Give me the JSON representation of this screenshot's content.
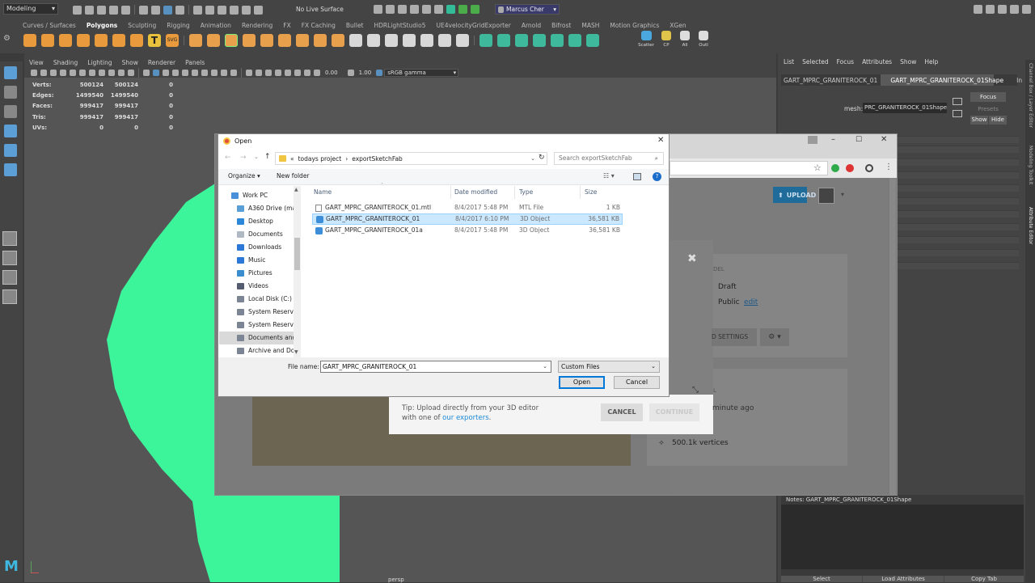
{
  "maya": {
    "mode": "Modeling",
    "live_surface": "No Live Surface",
    "user": "Marcus Cher",
    "shelf_tabs": [
      "Curves / Surfaces",
      "Polygons",
      "Sculpting",
      "Rigging",
      "Animation",
      "Rendering",
      "FX",
      "FX Caching",
      "Bullet",
      "HDRLightStudio5",
      "UE4velocityGridExporter",
      "Arnold",
      "Bifrost",
      "MASH",
      "Motion Graphics",
      "XGen"
    ],
    "shelf_labels": {
      "scatter": "Scatter",
      "cp": "CP",
      "all": "All",
      "outl": "Outl"
    },
    "viewport_menu": [
      "View",
      "Shading",
      "Lighting",
      "Show",
      "Renderer",
      "Panels"
    ],
    "exposure": "0.00",
    "gamma": "1.00",
    "color_space": "sRGB gamma",
    "hud": {
      "rows": [
        {
          "label": "Verts:",
          "a": "500124",
          "b": "500124",
          "c": "0"
        },
        {
          "label": "Edges:",
          "a": "1499540",
          "b": "1499540",
          "c": "0"
        },
        {
          "label": "Faces:",
          "a": "999417",
          "b": "999417",
          "c": "0"
        },
        {
          "label": "Tris:",
          "a": "999417",
          "b": "999417",
          "c": "0"
        },
        {
          "label": "UVs:",
          "a": "0",
          "b": "0",
          "c": "0"
        }
      ]
    },
    "camera_label": "persp",
    "right_panel": {
      "menu": [
        "List",
        "Selected",
        "Focus",
        "Attributes",
        "Show",
        "Help"
      ],
      "tabs": [
        "GART_MPRC_GRANITEROCK_01",
        "GART_MPRC_GRANITEROCK_01Shape",
        "In"
      ],
      "mesh_label": "mesh:",
      "mesh_value": "PRC_GRANITEROCK_01Shape",
      "focus": "Focus",
      "presets": "Presets",
      "show": "Show",
      "hide": "Hide",
      "notes": "Notes:  GART_MPRC_GRANITEROCK_01Shape",
      "bottom_buttons": [
        "Select",
        "Load Attributes",
        "Copy Tab"
      ],
      "side_tabs": [
        "Channel Box / Layer Editor",
        "Modeling Toolkit",
        "Attribute Editor"
      ]
    },
    "colors": {
      "rock": "#3cf59a",
      "accent": "#5c9fd6"
    }
  },
  "sketchfab": {
    "upload": "UPLOAD",
    "model_label": "DEL",
    "draft": "Draft",
    "public": "Public",
    "edit": "edit",
    "settings": "D SETTINGS",
    "time": "minute ago",
    "vertices": "500.1k vertices",
    "tip_prefix": "Tip:",
    "tip_text": "Upload directly from your 3D editor with one of",
    "tip_link": "our exporters",
    "cancel": "CANCEL",
    "continue": "CONTINUE",
    "l_small": "L"
  },
  "dialog": {
    "title": "Open",
    "path": [
      "«",
      "todays project",
      "›",
      "exportSketchFab"
    ],
    "search_placeholder": "Search exportSketchFab",
    "organize": "Organize ▾",
    "new_folder": "New folder",
    "nav": [
      {
        "label": "Work PC",
        "color": "#4a90d9",
        "indent": 0
      },
      {
        "label": "A360 Drive (mar",
        "color": "#5a9ed6",
        "indent": 1
      },
      {
        "label": "Desktop",
        "color": "#2b88d8",
        "indent": 1
      },
      {
        "label": "Documents",
        "color": "#b0b8c4",
        "indent": 1
      },
      {
        "label": "Downloads",
        "color": "#2b78d8",
        "indent": 1
      },
      {
        "label": "Music",
        "color": "#2b78d8",
        "indent": 1
      },
      {
        "label": "Pictures",
        "color": "#3a8ed0",
        "indent": 1
      },
      {
        "label": "Videos",
        "color": "#555c70",
        "indent": 1
      },
      {
        "label": "Local Disk (C:)",
        "color": "#7c8594",
        "indent": 1
      },
      {
        "label": "System Reservec",
        "color": "#7c8594",
        "indent": 1
      },
      {
        "label": "System Reservec",
        "color": "#7c8594",
        "indent": 1
      },
      {
        "label": "Documents and",
        "color": "#7c8594",
        "indent": 1
      },
      {
        "label": "Archive and Dov",
        "color": "#7c8594",
        "indent": 1
      }
    ],
    "columns": [
      "Name",
      "Date modified",
      "Type",
      "Size"
    ],
    "files": [
      {
        "name": "GART_MPRC_GRANITEROCK_01.mtl",
        "date": "8/4/2017 5:48 PM",
        "type": "MTL File",
        "size": "1 KB"
      },
      {
        "name": "GART_MPRC_GRANITEROCK_01",
        "date": "8/4/2017 6:10 PM",
        "type": "3D Object",
        "size": "36,581 KB"
      },
      {
        "name": "GART_MPRC_GRANITEROCK_01a",
        "date": "8/4/2017 5:48 PM",
        "type": "3D Object",
        "size": "36,581 KB"
      }
    ],
    "filename_label": "File name:",
    "filename": "GART_MPRC_GRANITEROCK_01",
    "filter": "Custom Files",
    "open": "Open",
    "cancel": "Cancel"
  }
}
